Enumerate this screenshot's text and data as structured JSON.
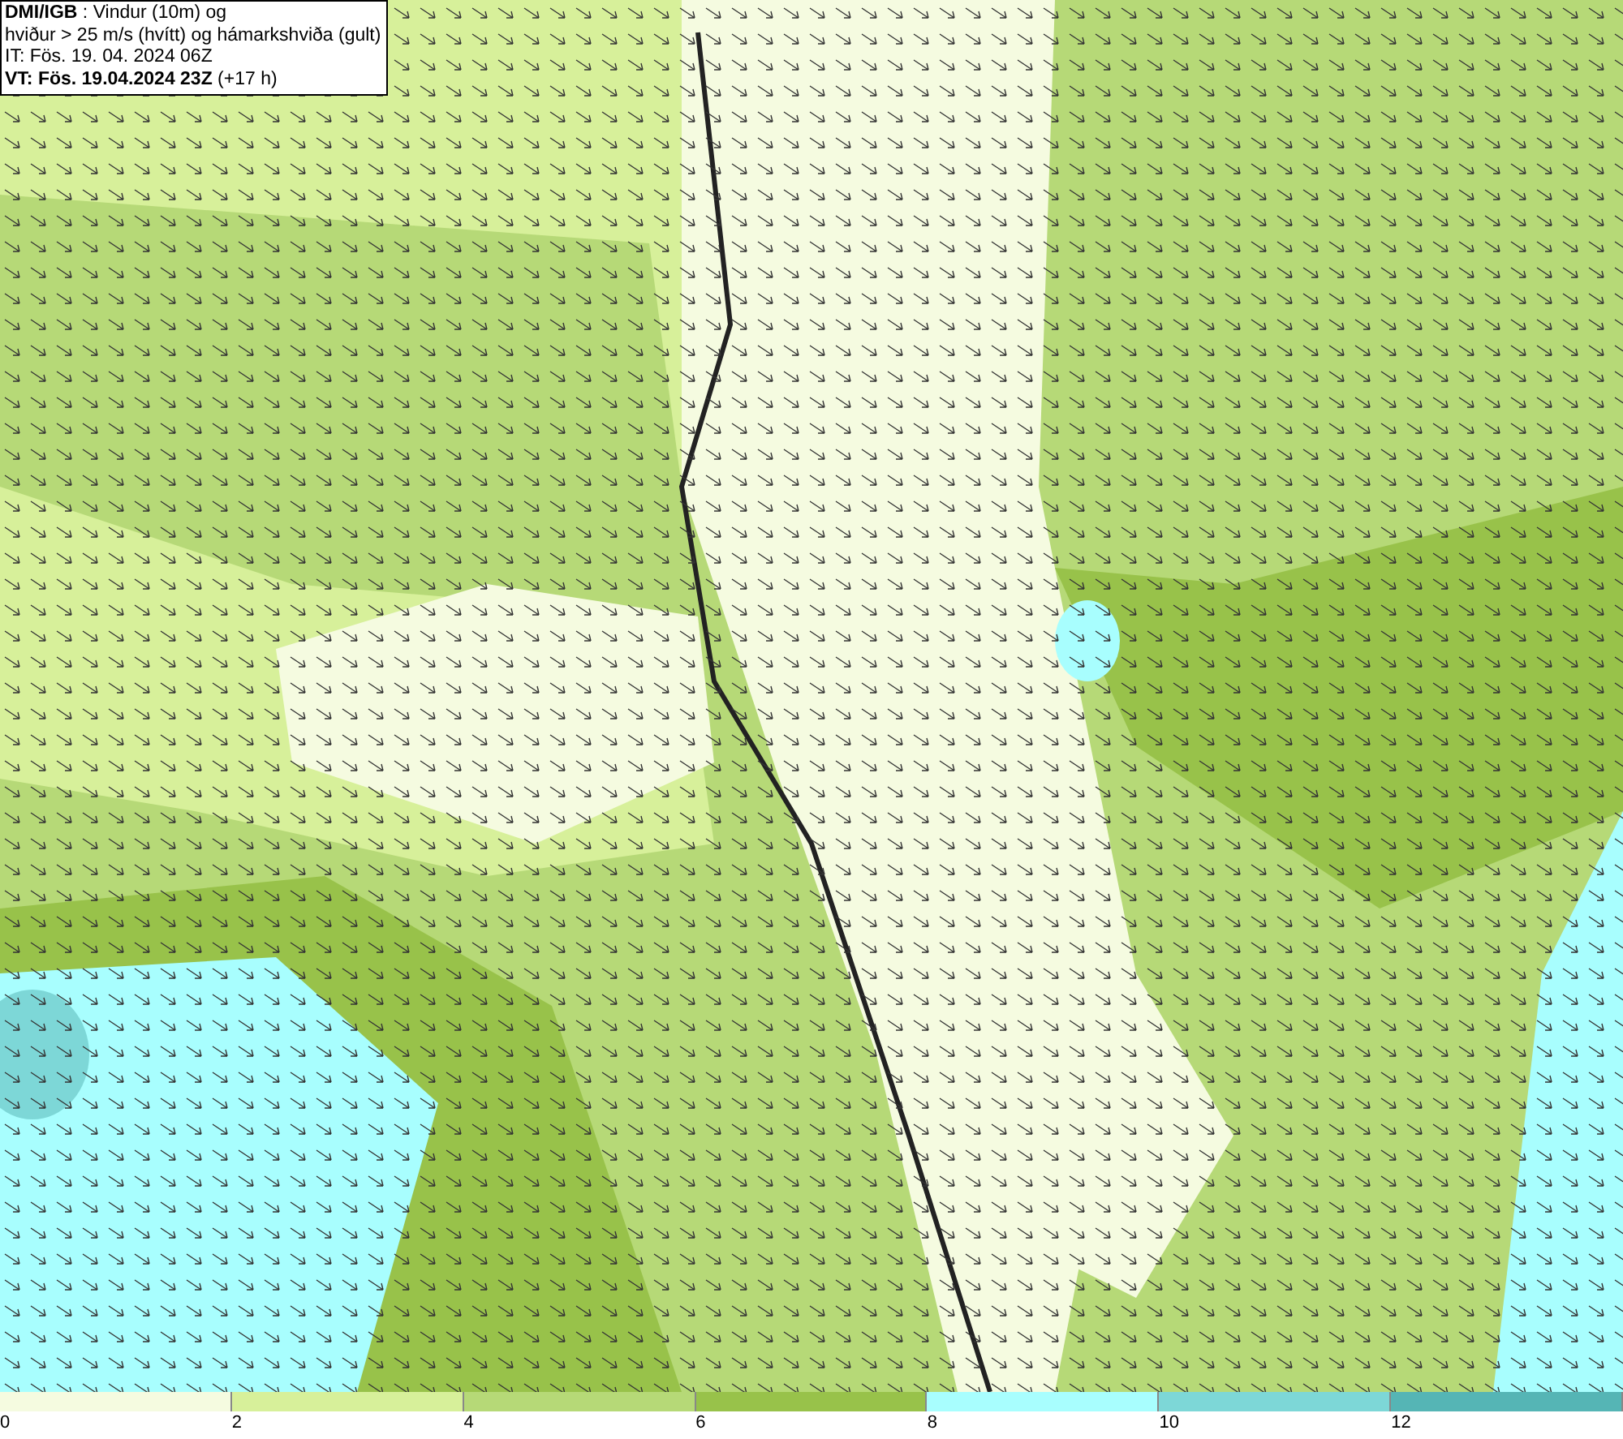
{
  "title_box": {
    "lines": [
      "**DMI/IGB** : Vindur (10m) og",
      "hviður > 25 m/s (hvítt) og hámarkshviða (gult)",
      "IT: Fös. 19. 04. 2024 06Z",
      "**VT: Fös. 19.04.2024 23Z** (+17 h)"
    ]
  },
  "legend": {
    "bins": [
      {
        "label": "0",
        "color": "#f5fbe0"
      },
      {
        "label": "2",
        "color": "#d7f09a"
      },
      {
        "label": "4",
        "color": "#b6d977"
      },
      {
        "label": "6",
        "color": "#98c24a"
      },
      {
        "label": "8",
        "color": "#a8fefe"
      },
      {
        "label": "10",
        "color": "#7dd7d7"
      },
      {
        "label": "12",
        "color": "#55b5b5"
      }
    ]
  }
}
